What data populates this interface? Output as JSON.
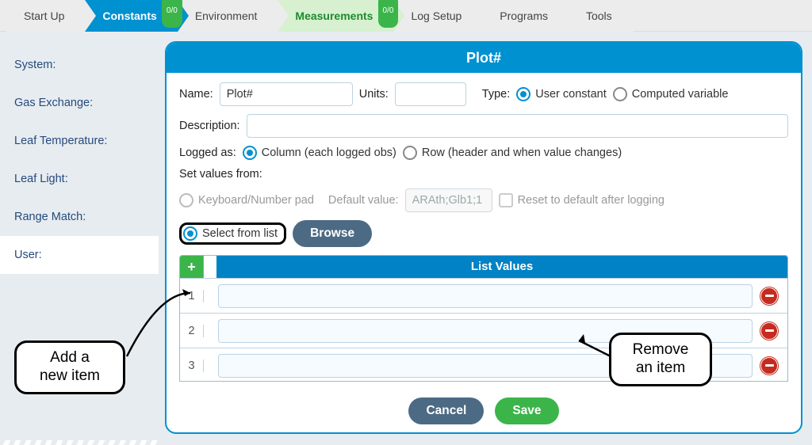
{
  "tabs": [
    "Start Up",
    "Constants",
    "Environment",
    "Measurements",
    "Log Setup",
    "Programs",
    "Tools"
  ],
  "badge": "0/0",
  "sidebar": [
    "System:",
    "Gas Exchange:",
    "Leaf Temperature:",
    "Leaf Light:",
    "Range Match:",
    "User:"
  ],
  "dlg": {
    "title": "Plot#",
    "name_lbl": "Name:",
    "name_val": "Plot#",
    "units_lbl": "Units:",
    "units_val": "",
    "type_lbl": "Type:",
    "type_user": "User constant",
    "type_comp": "Computed variable",
    "desc_lbl": "Description:",
    "desc_val": "",
    "logged_lbl": "Logged as:",
    "logged_col": "Column (each logged obs)",
    "logged_row": "Row (header and when value changes)",
    "sv_lbl": "Set values from:",
    "sv_key": "Keyboard/Number pad",
    "sv_def_lbl": "Default value:",
    "sv_def_val": "ARAth;Glb1;1",
    "sv_reset": "Reset to default after logging",
    "sv_list": "Select from list",
    "browse": "Browse",
    "list_head": "List Values",
    "rows": [
      "1",
      "2",
      "3"
    ],
    "cancel": "Cancel",
    "save": "Save"
  },
  "call": {
    "add": "Add a\nnew item",
    "remove": "Remove\nan item"
  }
}
